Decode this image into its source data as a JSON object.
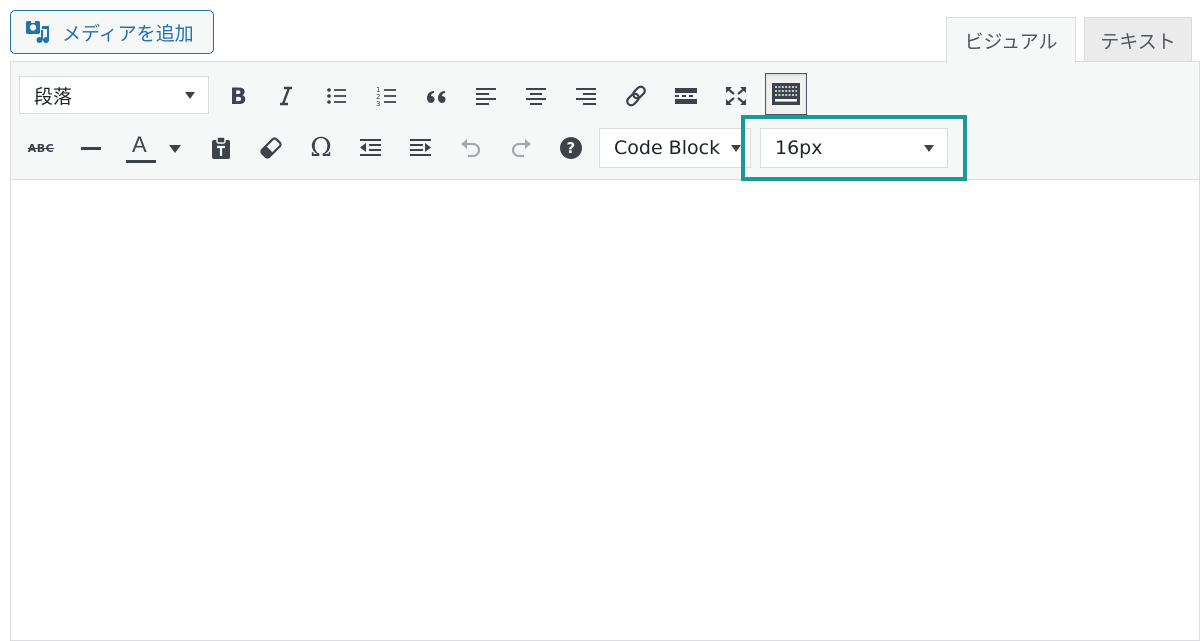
{
  "media_button": {
    "label": "メディアを追加",
    "icon": "media-icon"
  },
  "tabs": [
    {
      "label": "ビジュアル",
      "active": true
    },
    {
      "label": "テキスト",
      "active": false
    }
  ],
  "toolbar": {
    "format_select": {
      "value": "段落"
    },
    "row1_buttons": [
      "bold-icon",
      "italic-icon",
      "bullet-list-icon",
      "numbered-list-icon",
      "blockquote-icon",
      "align-left-icon",
      "align-center-icon",
      "align-right-icon",
      "link-icon",
      "read-more-icon",
      "fullscreen-icon",
      "toolbar-toggle-icon"
    ],
    "row2_buttons": [
      "strikethrough-icon",
      "horizontal-line-icon",
      "text-color-icon",
      "paste-text-icon",
      "clear-formatting-icon",
      "special-character-icon",
      "outdent-icon",
      "indent-icon",
      "undo-icon",
      "redo-icon",
      "help-icon"
    ],
    "strikethrough_label": "ABC",
    "text_color_label": "A",
    "special_character_label": "Ω",
    "code_block_select": {
      "value": "Code Block"
    },
    "font_size_select": {
      "value": "16px"
    }
  },
  "colors": {
    "accent": "#2271b1",
    "highlight": "#19999a",
    "toolbar_bg": "#f6f7f7",
    "icon": "#3c434a"
  }
}
